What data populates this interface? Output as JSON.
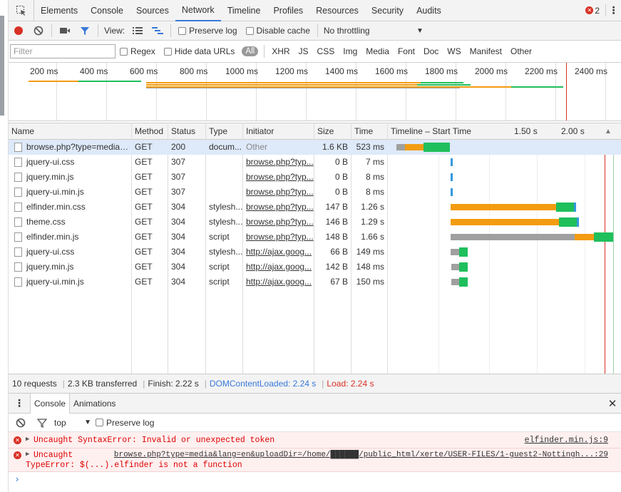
{
  "tabs": [
    "Elements",
    "Console",
    "Sources",
    "Network",
    "Timeline",
    "Profiles",
    "Resources",
    "Security",
    "Audits"
  ],
  "active_tab": "Network",
  "error_count": "2",
  "toolbar": {
    "view_label": "View:",
    "preserve_log": "Preserve log",
    "disable_cache": "Disable cache",
    "throttling": "No throttling"
  },
  "filterbar": {
    "placeholder": "Filter",
    "regex": "Regex",
    "hide_data_urls": "Hide data URLs",
    "types": [
      "All",
      "XHR",
      "JS",
      "CSS",
      "Img",
      "Media",
      "Font",
      "Doc",
      "WS",
      "Manifest",
      "Other"
    ]
  },
  "overview_ticks": [
    "200 ms",
    "400 ms",
    "600 ms",
    "800 ms",
    "1000 ms",
    "1200 ms",
    "1400 ms",
    "1600 ms",
    "1800 ms",
    "2000 ms",
    "2200 ms",
    "2400 ms"
  ],
  "columns": [
    "Name",
    "Method",
    "Status",
    "Type",
    "Initiator",
    "Size",
    "Time",
    "Timeline – Start Time"
  ],
  "waterfall_ticks": [
    "1.50 s",
    "2.00 s"
  ],
  "requests": [
    {
      "name": "browse.php?type=media&...",
      "method": "GET",
      "status": "200",
      "type": "docum...",
      "initiator": "Other",
      "size": "1.6 KB",
      "time": "523 ms"
    },
    {
      "name": "jquery-ui.css",
      "method": "GET",
      "status": "307",
      "type": "",
      "initiator": "browse.php?typ...",
      "size": "0 B",
      "time": "7 ms"
    },
    {
      "name": "jquery.min.js",
      "method": "GET",
      "status": "307",
      "type": "",
      "initiator": "browse.php?typ...",
      "size": "0 B",
      "time": "8 ms"
    },
    {
      "name": "jquery-ui.min.js",
      "method": "GET",
      "status": "307",
      "type": "",
      "initiator": "browse.php?typ...",
      "size": "0 B",
      "time": "8 ms"
    },
    {
      "name": "elfinder.min.css",
      "method": "GET",
      "status": "304",
      "type": "stylesh...",
      "initiator": "browse.php?typ...",
      "size": "147 B",
      "time": "1.26 s"
    },
    {
      "name": "theme.css",
      "method": "GET",
      "status": "304",
      "type": "stylesh...",
      "initiator": "browse.php?typ...",
      "size": "146 B",
      "time": "1.29 s"
    },
    {
      "name": "elfinder.min.js",
      "method": "GET",
      "status": "304",
      "type": "script",
      "initiator": "browse.php?typ...",
      "size": "148 B",
      "time": "1.66 s"
    },
    {
      "name": "jquery-ui.css",
      "method": "GET",
      "status": "304",
      "type": "stylesh...",
      "initiator": "http://ajax.goog...",
      "size": "66 B",
      "time": "149 ms"
    },
    {
      "name": "jquery.min.js",
      "method": "GET",
      "status": "304",
      "type": "script",
      "initiator": "http://ajax.goog...",
      "size": "142 B",
      "time": "148 ms"
    },
    {
      "name": "jquery-ui.min.js",
      "method": "GET",
      "status": "304",
      "type": "script",
      "initiator": "http://ajax.goog...",
      "size": "67 B",
      "time": "150 ms"
    }
  ],
  "summary": {
    "requests": "10 requests",
    "transferred": "2.3 KB transferred",
    "finish": "Finish: 2.22 s",
    "dcl": "DOMContentLoaded: 2.24 s",
    "load": "Load: 2.24 s"
  },
  "drawer": {
    "tabs": [
      "Console",
      "Animations"
    ],
    "context": "top",
    "preserve_log": "Preserve log"
  },
  "console_messages": [
    {
      "text": "Uncaught SyntaxError: Invalid or unexpected token",
      "source": "elfinder.min.js:9"
    },
    {
      "text1": "Uncaught",
      "text2": "TypeError: $(...).elfinder is not a function",
      "source": "browse.php?type=media&lang=en&uploadDir=/home/██████/public_html/xerte/USER-FILES/1-guest2-Nottingh...:29"
    }
  ],
  "prompt_symbol": "›",
  "colors": {
    "waiting": "#f39c12",
    "download": "#1fbf5c",
    "blocked": "#a0a0a0",
    "dcl": "#3879d9",
    "load": "#d93025"
  }
}
